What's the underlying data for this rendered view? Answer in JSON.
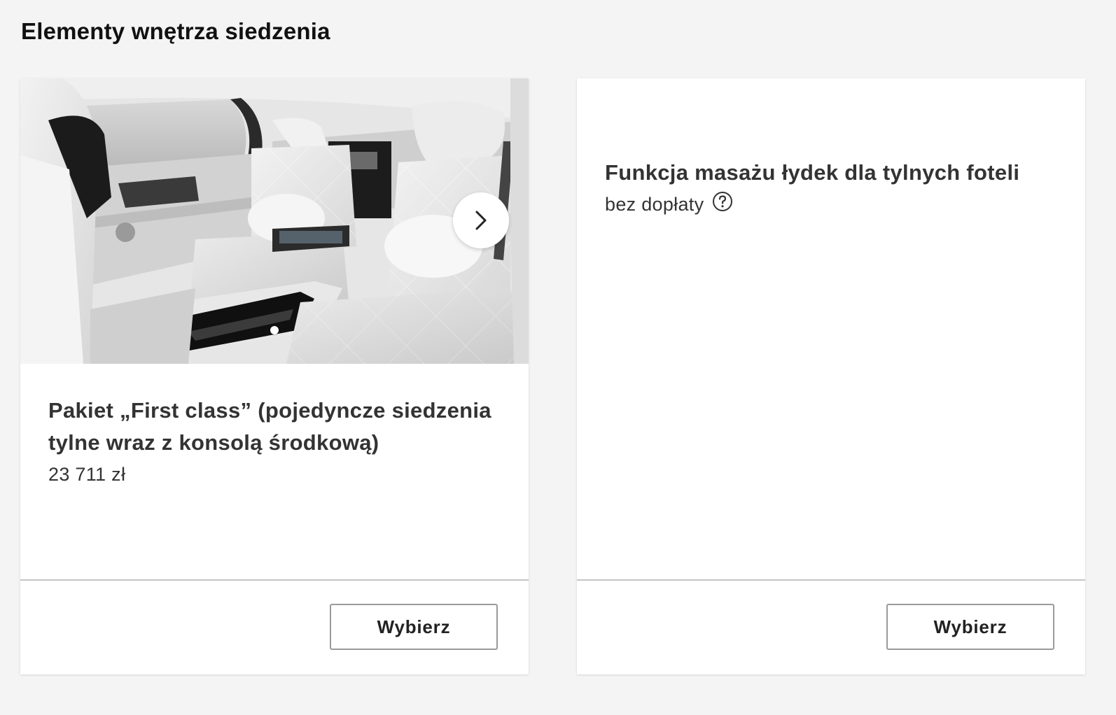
{
  "section": {
    "title": "Elementy wnętrza siedzenia"
  },
  "cards": [
    {
      "title": "Pakiet „First class” (pojedyncze siedzenia tylne wraz z konsolą środkową)",
      "price": "23 711 zł",
      "button_label": "Wybierz",
      "next_icon": "chevron-right-icon",
      "gallery_dots": 1,
      "image_alt": "interior-rear-seats-photo"
    },
    {
      "title": "Funkcja masażu łydek dla tylnych foteli",
      "price": "bez dopłaty",
      "help_icon": "question-circle-icon",
      "button_label": "Wybierz"
    }
  ],
  "colors": {
    "page_background": "#f4f4f4",
    "card_background": "#ffffff",
    "text_primary": "#333333",
    "button_border": "#9a9a9a"
  }
}
